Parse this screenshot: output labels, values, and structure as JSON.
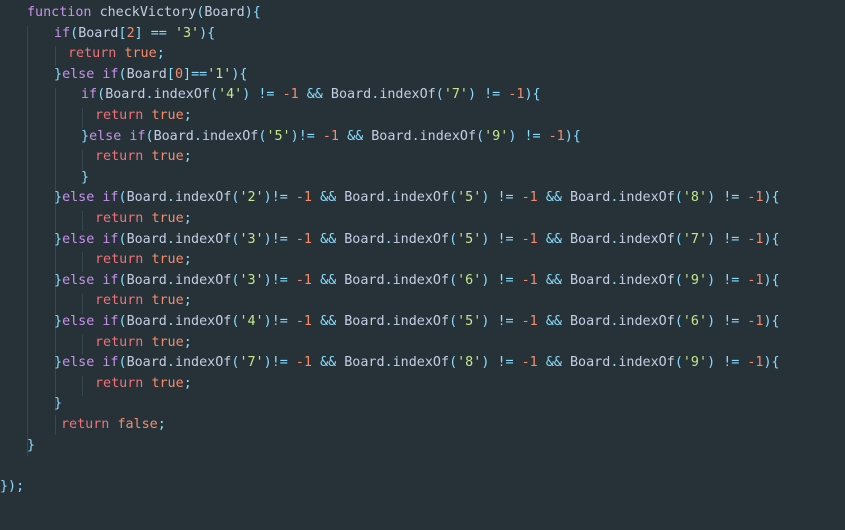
{
  "editor": {
    "background": "#263238",
    "language": "javascript",
    "lines": [
      [
        {
          "t": "function ",
          "c": "kw"
        },
        {
          "t": "checkVictory",
          "c": "fn"
        },
        {
          "t": "(",
          "c": "punc"
        },
        {
          "t": "Board",
          "c": "id"
        },
        {
          "t": "){",
          "c": "punc"
        }
      ],
      [
        {
          "t": "if",
          "c": "kw"
        },
        {
          "t": "(",
          "c": "punc"
        },
        {
          "t": "Board",
          "c": "id"
        },
        {
          "t": "[",
          "c": "punc"
        },
        {
          "t": "2",
          "c": "num"
        },
        {
          "t": "] ",
          "c": "punc"
        },
        {
          "t": "==",
          "c": "op"
        },
        {
          "t": " ",
          "c": "id"
        },
        {
          "t": "'3'",
          "c": "str"
        },
        {
          "t": "){",
          "c": "punc"
        }
      ],
      [
        {
          "t": "return ",
          "c": "kw2"
        },
        {
          "t": "true",
          "c": "bool"
        },
        {
          "t": ";",
          "c": "punc"
        }
      ],
      [
        {
          "t": "}",
          "c": "punc"
        },
        {
          "t": "else ",
          "c": "kw"
        },
        {
          "t": "if",
          "c": "kw"
        },
        {
          "t": "(",
          "c": "punc"
        },
        {
          "t": "Board",
          "c": "id"
        },
        {
          "t": "[",
          "c": "punc"
        },
        {
          "t": "0",
          "c": "num"
        },
        {
          "t": "]",
          "c": "punc"
        },
        {
          "t": "==",
          "c": "op"
        },
        {
          "t": "'1'",
          "c": "str"
        },
        {
          "t": "){",
          "c": "punc"
        }
      ],
      [
        {
          "t": "if",
          "c": "kw"
        },
        {
          "t": "(",
          "c": "punc"
        },
        {
          "t": "Board",
          "c": "id"
        },
        {
          "t": ".",
          "c": "punc"
        },
        {
          "t": "indexOf",
          "c": "fn"
        },
        {
          "t": "(",
          "c": "punc"
        },
        {
          "t": "'4'",
          "c": "str"
        },
        {
          "t": ") ",
          "c": "punc"
        },
        {
          "t": "!=",
          "c": "op"
        },
        {
          "t": " ",
          "c": "id"
        },
        {
          "t": "-1",
          "c": "num"
        },
        {
          "t": " ",
          "c": "id"
        },
        {
          "t": "&&",
          "c": "op"
        },
        {
          "t": " Board",
          "c": "id"
        },
        {
          "t": ".",
          "c": "punc"
        },
        {
          "t": "indexOf",
          "c": "fn"
        },
        {
          "t": "(",
          "c": "punc"
        },
        {
          "t": "'7'",
          "c": "str"
        },
        {
          "t": ") ",
          "c": "punc"
        },
        {
          "t": "!=",
          "c": "op"
        },
        {
          "t": " ",
          "c": "id"
        },
        {
          "t": "-1",
          "c": "num"
        },
        {
          "t": "){",
          "c": "punc"
        }
      ],
      [
        {
          "t": "return ",
          "c": "kw2"
        },
        {
          "t": "true",
          "c": "bool"
        },
        {
          "t": ";",
          "c": "punc"
        }
      ],
      [
        {
          "t": "}",
          "c": "punc"
        },
        {
          "t": "else ",
          "c": "kw"
        },
        {
          "t": "if",
          "c": "kw"
        },
        {
          "t": "(",
          "c": "punc"
        },
        {
          "t": "Board",
          "c": "id"
        },
        {
          "t": ".",
          "c": "punc"
        },
        {
          "t": "indexOf",
          "c": "fn"
        },
        {
          "t": "(",
          "c": "punc"
        },
        {
          "t": "'5'",
          "c": "str"
        },
        {
          "t": ")",
          "c": "punc"
        },
        {
          "t": "!=",
          "c": "op"
        },
        {
          "t": " ",
          "c": "id"
        },
        {
          "t": "-1",
          "c": "num"
        },
        {
          "t": " ",
          "c": "id"
        },
        {
          "t": "&&",
          "c": "op"
        },
        {
          "t": " Board",
          "c": "id"
        },
        {
          "t": ".",
          "c": "punc"
        },
        {
          "t": "indexOf",
          "c": "fn"
        },
        {
          "t": "(",
          "c": "punc"
        },
        {
          "t": "'9'",
          "c": "str"
        },
        {
          "t": ") ",
          "c": "punc"
        },
        {
          "t": "!=",
          "c": "op"
        },
        {
          "t": " ",
          "c": "id"
        },
        {
          "t": "-1",
          "c": "num"
        },
        {
          "t": "){",
          "c": "punc"
        }
      ],
      [
        {
          "t": "return ",
          "c": "kw2"
        },
        {
          "t": "true",
          "c": "bool"
        },
        {
          "t": ";",
          "c": "punc"
        }
      ],
      [
        {
          "t": "}",
          "c": "punc"
        }
      ],
      [
        {
          "t": "}",
          "c": "punc"
        },
        {
          "t": "else ",
          "c": "kw"
        },
        {
          "t": "if",
          "c": "kw"
        },
        {
          "t": "(",
          "c": "punc"
        },
        {
          "t": "Board",
          "c": "id"
        },
        {
          "t": ".",
          "c": "punc"
        },
        {
          "t": "indexOf",
          "c": "fn"
        },
        {
          "t": "(",
          "c": "punc"
        },
        {
          "t": "'2'",
          "c": "str"
        },
        {
          "t": ")",
          "c": "punc"
        },
        {
          "t": "!=",
          "c": "op"
        },
        {
          "t": " ",
          "c": "id"
        },
        {
          "t": "-1",
          "c": "num"
        },
        {
          "t": " ",
          "c": "id"
        },
        {
          "t": "&&",
          "c": "op"
        },
        {
          "t": " Board",
          "c": "id"
        },
        {
          "t": ".",
          "c": "punc"
        },
        {
          "t": "indexOf",
          "c": "fn"
        },
        {
          "t": "(",
          "c": "punc"
        },
        {
          "t": "'5'",
          "c": "str"
        },
        {
          "t": ") ",
          "c": "punc"
        },
        {
          "t": "!=",
          "c": "op"
        },
        {
          "t": " ",
          "c": "id"
        },
        {
          "t": "-1",
          "c": "num"
        },
        {
          "t": " ",
          "c": "id"
        },
        {
          "t": "&&",
          "c": "op"
        },
        {
          "t": " Board",
          "c": "id"
        },
        {
          "t": ".",
          "c": "punc"
        },
        {
          "t": "indexOf",
          "c": "fn"
        },
        {
          "t": "(",
          "c": "punc"
        },
        {
          "t": "'8'",
          "c": "str"
        },
        {
          "t": ") ",
          "c": "punc"
        },
        {
          "t": "!=",
          "c": "op"
        },
        {
          "t": " ",
          "c": "id"
        },
        {
          "t": "-1",
          "c": "num"
        },
        {
          "t": "){",
          "c": "punc"
        }
      ],
      [
        {
          "t": "return ",
          "c": "kw2"
        },
        {
          "t": "true",
          "c": "bool"
        },
        {
          "t": ";",
          "c": "punc"
        }
      ],
      [
        {
          "t": "}",
          "c": "punc"
        },
        {
          "t": "else ",
          "c": "kw"
        },
        {
          "t": "if",
          "c": "kw"
        },
        {
          "t": "(",
          "c": "punc"
        },
        {
          "t": "Board",
          "c": "id"
        },
        {
          "t": ".",
          "c": "punc"
        },
        {
          "t": "indexOf",
          "c": "fn"
        },
        {
          "t": "(",
          "c": "punc"
        },
        {
          "t": "'3'",
          "c": "str"
        },
        {
          "t": ")",
          "c": "punc"
        },
        {
          "t": "!=",
          "c": "op"
        },
        {
          "t": " ",
          "c": "id"
        },
        {
          "t": "-1",
          "c": "num"
        },
        {
          "t": " ",
          "c": "id"
        },
        {
          "t": "&&",
          "c": "op"
        },
        {
          "t": " Board",
          "c": "id"
        },
        {
          "t": ".",
          "c": "punc"
        },
        {
          "t": "indexOf",
          "c": "fn"
        },
        {
          "t": "(",
          "c": "punc"
        },
        {
          "t": "'5'",
          "c": "str"
        },
        {
          "t": ") ",
          "c": "punc"
        },
        {
          "t": "!=",
          "c": "op"
        },
        {
          "t": " ",
          "c": "id"
        },
        {
          "t": "-1",
          "c": "num"
        },
        {
          "t": " ",
          "c": "id"
        },
        {
          "t": "&&",
          "c": "op"
        },
        {
          "t": " Board",
          "c": "id"
        },
        {
          "t": ".",
          "c": "punc"
        },
        {
          "t": "indexOf",
          "c": "fn"
        },
        {
          "t": "(",
          "c": "punc"
        },
        {
          "t": "'7'",
          "c": "str"
        },
        {
          "t": ") ",
          "c": "punc"
        },
        {
          "t": "!=",
          "c": "op"
        },
        {
          "t": " ",
          "c": "id"
        },
        {
          "t": "-1",
          "c": "num"
        },
        {
          "t": "){",
          "c": "punc"
        }
      ],
      [
        {
          "t": "return ",
          "c": "kw2"
        },
        {
          "t": "true",
          "c": "bool"
        },
        {
          "t": ";",
          "c": "punc"
        }
      ],
      [
        {
          "t": "}",
          "c": "punc"
        },
        {
          "t": "else ",
          "c": "kw"
        },
        {
          "t": "if",
          "c": "kw"
        },
        {
          "t": "(",
          "c": "punc"
        },
        {
          "t": "Board",
          "c": "id"
        },
        {
          "t": ".",
          "c": "punc"
        },
        {
          "t": "indexOf",
          "c": "fn"
        },
        {
          "t": "(",
          "c": "punc"
        },
        {
          "t": "'3'",
          "c": "str"
        },
        {
          "t": ")",
          "c": "punc"
        },
        {
          "t": "!=",
          "c": "op"
        },
        {
          "t": " ",
          "c": "id"
        },
        {
          "t": "-1",
          "c": "num"
        },
        {
          "t": " ",
          "c": "id"
        },
        {
          "t": "&&",
          "c": "op"
        },
        {
          "t": " Board",
          "c": "id"
        },
        {
          "t": ".",
          "c": "punc"
        },
        {
          "t": "indexOf",
          "c": "fn"
        },
        {
          "t": "(",
          "c": "punc"
        },
        {
          "t": "'6'",
          "c": "str"
        },
        {
          "t": ") ",
          "c": "punc"
        },
        {
          "t": "!=",
          "c": "op"
        },
        {
          "t": " ",
          "c": "id"
        },
        {
          "t": "-1",
          "c": "num"
        },
        {
          "t": " ",
          "c": "id"
        },
        {
          "t": "&&",
          "c": "op"
        },
        {
          "t": " Board",
          "c": "id"
        },
        {
          "t": ".",
          "c": "punc"
        },
        {
          "t": "indexOf",
          "c": "fn"
        },
        {
          "t": "(",
          "c": "punc"
        },
        {
          "t": "'9'",
          "c": "str"
        },
        {
          "t": ") ",
          "c": "punc"
        },
        {
          "t": "!=",
          "c": "op"
        },
        {
          "t": " ",
          "c": "id"
        },
        {
          "t": "-1",
          "c": "num"
        },
        {
          "t": "){",
          "c": "punc"
        }
      ],
      [
        {
          "t": "return ",
          "c": "kw2"
        },
        {
          "t": "true",
          "c": "bool"
        },
        {
          "t": ";",
          "c": "punc"
        }
      ],
      [
        {
          "t": "}",
          "c": "punc"
        },
        {
          "t": "else ",
          "c": "kw"
        },
        {
          "t": "if",
          "c": "kw"
        },
        {
          "t": "(",
          "c": "punc"
        },
        {
          "t": "Board",
          "c": "id"
        },
        {
          "t": ".",
          "c": "punc"
        },
        {
          "t": "indexOf",
          "c": "fn"
        },
        {
          "t": "(",
          "c": "punc"
        },
        {
          "t": "'4'",
          "c": "str"
        },
        {
          "t": ")",
          "c": "punc"
        },
        {
          "t": "!=",
          "c": "op"
        },
        {
          "t": " ",
          "c": "id"
        },
        {
          "t": "-1",
          "c": "num"
        },
        {
          "t": " ",
          "c": "id"
        },
        {
          "t": "&&",
          "c": "op"
        },
        {
          "t": " Board",
          "c": "id"
        },
        {
          "t": ".",
          "c": "punc"
        },
        {
          "t": "indexOf",
          "c": "fn"
        },
        {
          "t": "(",
          "c": "punc"
        },
        {
          "t": "'5'",
          "c": "str"
        },
        {
          "t": ") ",
          "c": "punc"
        },
        {
          "t": "!=",
          "c": "op"
        },
        {
          "t": " ",
          "c": "id"
        },
        {
          "t": "-1",
          "c": "num"
        },
        {
          "t": " ",
          "c": "id"
        },
        {
          "t": "&&",
          "c": "op"
        },
        {
          "t": " Board",
          "c": "id"
        },
        {
          "t": ".",
          "c": "punc"
        },
        {
          "t": "indexOf",
          "c": "fn"
        },
        {
          "t": "(",
          "c": "punc"
        },
        {
          "t": "'6'",
          "c": "str"
        },
        {
          "t": ") ",
          "c": "punc"
        },
        {
          "t": "!=",
          "c": "op"
        },
        {
          "t": " ",
          "c": "id"
        },
        {
          "t": "-1",
          "c": "num"
        },
        {
          "t": "){",
          "c": "punc"
        }
      ],
      [
        {
          "t": "return ",
          "c": "kw2"
        },
        {
          "t": "true",
          "c": "bool"
        },
        {
          "t": ";",
          "c": "punc"
        }
      ],
      [
        {
          "t": "}",
          "c": "punc"
        },
        {
          "t": "else ",
          "c": "kw"
        },
        {
          "t": "if",
          "c": "kw"
        },
        {
          "t": "(",
          "c": "punc"
        },
        {
          "t": "Board",
          "c": "id"
        },
        {
          "t": ".",
          "c": "punc"
        },
        {
          "t": "indexOf",
          "c": "fn"
        },
        {
          "t": "(",
          "c": "punc"
        },
        {
          "t": "'7'",
          "c": "str"
        },
        {
          "t": ")",
          "c": "punc"
        },
        {
          "t": "!=",
          "c": "op"
        },
        {
          "t": " ",
          "c": "id"
        },
        {
          "t": "-1",
          "c": "num"
        },
        {
          "t": " ",
          "c": "id"
        },
        {
          "t": "&&",
          "c": "op"
        },
        {
          "t": " Board",
          "c": "id"
        },
        {
          "t": ".",
          "c": "punc"
        },
        {
          "t": "indexOf",
          "c": "fn"
        },
        {
          "t": "(",
          "c": "punc"
        },
        {
          "t": "'8'",
          "c": "str"
        },
        {
          "t": ") ",
          "c": "punc"
        },
        {
          "t": "!=",
          "c": "op"
        },
        {
          "t": " ",
          "c": "id"
        },
        {
          "t": "-1",
          "c": "num"
        },
        {
          "t": " ",
          "c": "id"
        },
        {
          "t": "&&",
          "c": "op"
        },
        {
          "t": " Board",
          "c": "id"
        },
        {
          "t": ".",
          "c": "punc"
        },
        {
          "t": "indexOf",
          "c": "fn"
        },
        {
          "t": "(",
          "c": "punc"
        },
        {
          "t": "'9'",
          "c": "str"
        },
        {
          "t": ") ",
          "c": "punc"
        },
        {
          "t": "!=",
          "c": "op"
        },
        {
          "t": " ",
          "c": "id"
        },
        {
          "t": "-1",
          "c": "num"
        },
        {
          "t": "){",
          "c": "punc"
        }
      ],
      [
        {
          "t": "return ",
          "c": "kw2"
        },
        {
          "t": "true",
          "c": "bool"
        },
        {
          "t": ";",
          "c": "punc"
        }
      ],
      [
        {
          "t": "}",
          "c": "punc"
        }
      ],
      [
        {
          "t": "return ",
          "c": "kw2"
        },
        {
          "t": "false",
          "c": "bool"
        },
        {
          "t": ";",
          "c": "punc"
        }
      ],
      [
        {
          "t": "}",
          "c": "punc"
        }
      ],
      [],
      [
        {
          "t": "});",
          "c": "punc"
        }
      ]
    ]
  }
}
